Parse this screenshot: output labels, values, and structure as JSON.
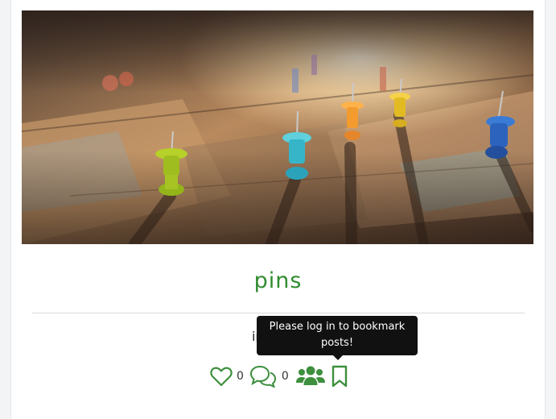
{
  "post": {
    "title": "pins",
    "caption": "image 1",
    "image_alt": "Colorful push pins on a map"
  },
  "actions": {
    "like_count": "0",
    "comment_count": "0"
  },
  "tooltip": {
    "text": "Please log in to bookmark posts!"
  },
  "icons": [
    "heart-outline-icon",
    "comments-icon",
    "users-icon",
    "bookmark-icon"
  ],
  "colors": {
    "accent": "#3d8f3d",
    "title": "#2f8c2f",
    "tooltip_bg": "#111111"
  }
}
